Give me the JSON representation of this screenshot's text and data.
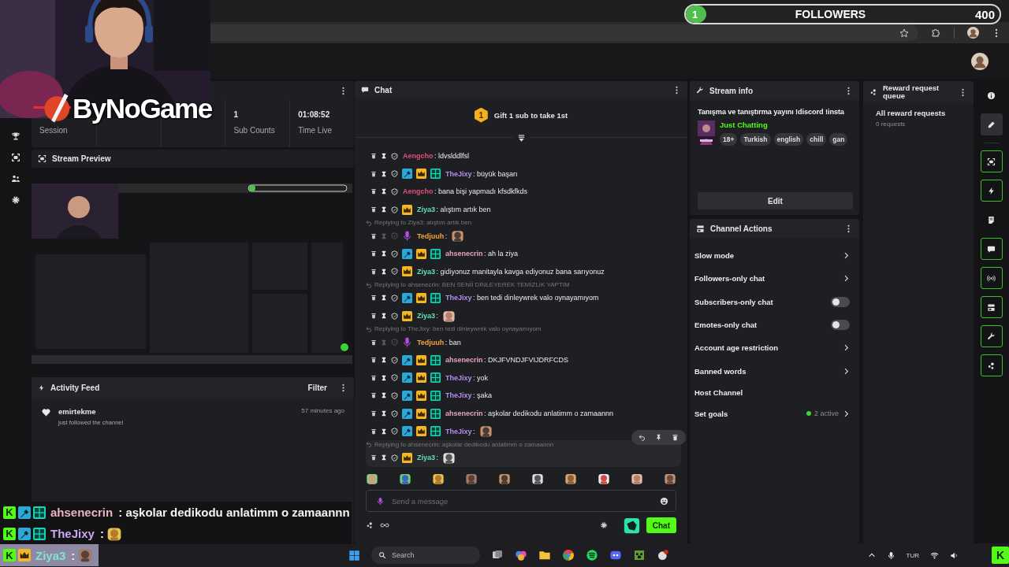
{
  "goal": {
    "count": "1",
    "label": "FOLLOWERS",
    "target": "400",
    "level": 0.0025
  },
  "overlay_logo": {
    "text": "ByNoGame"
  },
  "stats": [
    {
      "label": "Session"
    },
    {
      "value": "1",
      "label": "Sub Counts"
    },
    {
      "value": "01:08:52",
      "label": "Time Live"
    }
  ],
  "preview": {
    "title": "Stream Preview"
  },
  "activity": {
    "title": "Activity Feed",
    "filter": "Filter",
    "events": [
      {
        "user": "emirtekme",
        "action": "just followed the channel",
        "time": "57 minutes ago"
      }
    ]
  },
  "chat": {
    "title": "Chat",
    "gift": {
      "rank": "1",
      "text": "Gift 1 sub to take 1st"
    },
    "messages": [
      {
        "user": "Aengcho",
        "color": "#e0507a",
        "text": ": ldvslddlfsl",
        "emote": false,
        "moderation_disabled": false,
        "hovered": false
      },
      {
        "user": "TheJixy",
        "color": "#b68cf2",
        "badges": [
          {
            "kind": "moderator"
          },
          {
            "kind": "vip"
          },
          {
            "kind": "og"
          }
        ],
        "text": ": büyük başarı",
        "emote": false,
        "moderation_disabled": false,
        "hovered": false
      },
      {
        "user": "Aengcho",
        "color": "#e0507a",
        "text": ": bana bişi yapmadı kfsdkfkds",
        "emote": false,
        "moderation_disabled": false,
        "hovered": false
      },
      {
        "user": "Ziya3",
        "color": "#5fe3b5",
        "badges": [
          {
            "kind": "vip"
          }
        ],
        "text": ": alıştım artık ben",
        "emote": false,
        "moderation_disabled": false,
        "hovered": false
      },
      {
        "reply_to": "Replying to Ziya3: alıştım artık ben",
        "user": "Tedjuuh",
        "color": "#f0a33a",
        "badges": [
          {
            "kind": "mic"
          }
        ],
        "text": ":",
        "emote": true,
        "moderation_disabled": true,
        "hovered": false
      },
      {
        "user": "ahsenecrin",
        "color": "#e2a6b8",
        "badges": [
          {
            "kind": "moderator"
          },
          {
            "kind": "vip"
          },
          {
            "kind": "og"
          }
        ],
        "text": ": ah la ziya",
        "emote": false,
        "moderation_disabled": false,
        "hovered": false
      },
      {
        "user": "Ziya3",
        "color": "#5fe3b5",
        "badges": [
          {
            "kind": "vip"
          }
        ],
        "text": ": gidiyonuz manitayla kavga ediyonuz bana sarıyonuz",
        "emote": false,
        "moderation_disabled": false,
        "hovered": false
      },
      {
        "reply_to": "Replying to ahsenecrin: BEN SENİİ DİNLEYEREK TEMİZLİK YAPTIM",
        "user": "TheJixy",
        "color": "#b68cf2",
        "badges": [
          {
            "kind": "moderator"
          },
          {
            "kind": "vip"
          },
          {
            "kind": "og"
          }
        ],
        "text": ": ben tedi dinleywrek valo oynayamıyom",
        "emote": false,
        "moderation_disabled": false,
        "hovered": false
      },
      {
        "user": "Ziya3",
        "color": "#5fe3b5",
        "badges": [
          {
            "kind": "vip"
          }
        ],
        "text": ":",
        "emote": true,
        "moderation_disabled": false,
        "hovered": false
      },
      {
        "reply_to": "Replying to TheJixy: ben tedi dinleywrek valo oynayamıyom",
        "user": "Tedjuuh",
        "color": "#f0a33a",
        "badges": [
          {
            "kind": "mic"
          }
        ],
        "text": ": ban",
        "emote": false,
        "moderation_disabled": true,
        "hovered": false
      },
      {
        "user": "ahsenecrin",
        "color": "#e2a6b8",
        "badges": [
          {
            "kind": "moderator"
          },
          {
            "kind": "vip"
          },
          {
            "kind": "og"
          }
        ],
        "text": ": DKJFVNDJFVIJDRFCDS",
        "emote": false,
        "moderation_disabled": false,
        "hovered": false
      },
      {
        "user": "TheJixy",
        "color": "#b68cf2",
        "badges": [
          {
            "kind": "moderator"
          },
          {
            "kind": "vip"
          },
          {
            "kind": "og"
          }
        ],
        "text": ": yok",
        "emote": false,
        "moderation_disabled": false,
        "hovered": false
      },
      {
        "user": "TheJixy",
        "color": "#b68cf2",
        "badges": [
          {
            "kind": "moderator"
          },
          {
            "kind": "vip"
          },
          {
            "kind": "og"
          }
        ],
        "text": ": şaka",
        "emote": false,
        "moderation_disabled": false,
        "hovered": false
      },
      {
        "user": "ahsenecrin",
        "color": "#e2a6b8",
        "badges": [
          {
            "kind": "moderator"
          },
          {
            "kind": "vip"
          },
          {
            "kind": "og"
          }
        ],
        "text": ": aşkolar dedikodu anlatimm o zamaannn",
        "emote": false,
        "moderation_disabled": false,
        "hovered": false
      },
      {
        "user": "TheJixy",
        "color": "#b68cf2",
        "badges": [
          {
            "kind": "moderator"
          },
          {
            "kind": "vip"
          },
          {
            "kind": "og"
          }
        ],
        "text": ":",
        "emote": true,
        "moderation_disabled": false,
        "hovered": false
      },
      {
        "reply_to": "Replying to ahsenecrin: aşkolar dedikodu anlatimm o zamaannn",
        "user": "Ziya3",
        "color": "#5fe3b5",
        "badges": [
          {
            "kind": "vip"
          }
        ],
        "text": ":",
        "emote": true,
        "moderation_disabled": false,
        "hovered": true
      }
    ],
    "placeholder": "Send a message",
    "send": "Chat"
  },
  "stream_info": {
    "title": "Stream info",
    "stream_title": "Tanışma ve tanıştırma yayını !discord !insta",
    "category": "Just Chatting",
    "tags": [
      "18+",
      "Turkish",
      "english",
      "chill",
      "gan"
    ],
    "edit": "Edit"
  },
  "channel_actions": {
    "title": "Channel Actions",
    "items": [
      {
        "label": "Slow mode",
        "kind": "link"
      },
      {
        "label": "Followers-only chat",
        "kind": "link"
      },
      {
        "label": "Subscribers-only chat",
        "kind": "toggle",
        "on": false
      },
      {
        "label": "Emotes-only chat",
        "kind": "toggle",
        "on": false
      },
      {
        "label": "Account age restriction",
        "kind": "link"
      },
      {
        "label": "Banned words",
        "kind": "link"
      },
      {
        "label": "Host Channel",
        "kind": "plain"
      },
      {
        "label": "Set goals",
        "kind": "link",
        "status": "2 active"
      }
    ]
  },
  "reward_queue": {
    "title": "Reward request queue",
    "heading": "All reward requests",
    "count": "0 requests"
  },
  "tool_rail": [
    {
      "selected": false,
      "enabled": false
    },
    {
      "selected": true,
      "enabled": false
    },
    {
      "selected": false,
      "enabled": true
    },
    {
      "selected": false,
      "enabled": true
    },
    {
      "selected": false,
      "enabled": false
    },
    {
      "selected": false,
      "enabled": true
    },
    {
      "selected": false,
      "enabled": true
    },
    {
      "selected": false,
      "enabled": true
    },
    {
      "selected": false,
      "enabled": true
    },
    {
      "selected": false,
      "enabled": true
    }
  ],
  "overlay_chat": [
    {
      "platform": "K",
      "badges": [
        {
          "kind": "moderator"
        },
        {
          "kind": "og"
        }
      ],
      "user": "ahsenecrin",
      "color": "#e8b4c4",
      "text": ": aşkolar dedikodu anlatimm o zamaannn",
      "emote": false
    },
    {
      "platform": "K",
      "badges": [
        {
          "kind": "moderator"
        },
        {
          "kind": "og"
        }
      ],
      "user": "TheJixy",
      "color": "#c9a8f0",
      "text": ":",
      "emote": true
    },
    {
      "platform": "K",
      "badges": [
        {
          "kind": "vip"
        }
      ],
      "user": "Ziya3",
      "color": "#7fe3d0",
      "text": ":",
      "emote": true
    }
  ],
  "taskbar": {
    "search": {
      "placeholder": "Search"
    },
    "language": "TUR",
    "tray_badge": "K"
  }
}
